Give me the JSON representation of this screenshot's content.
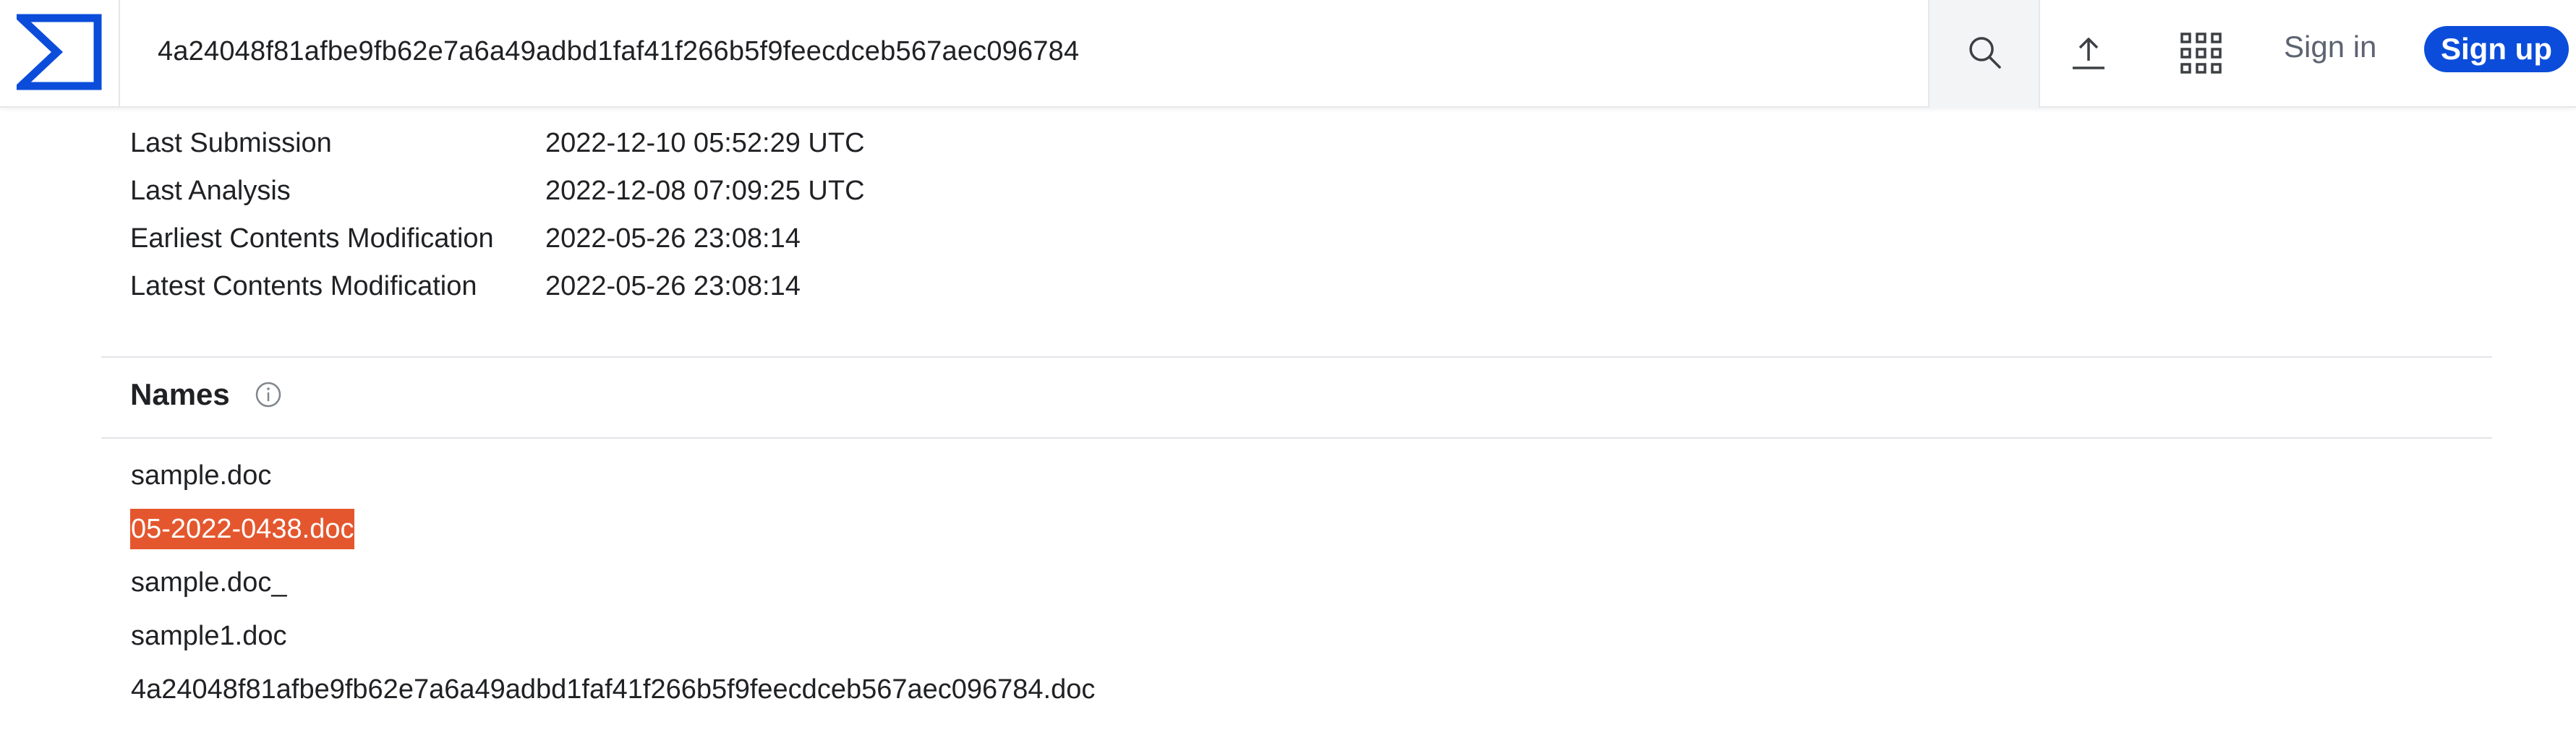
{
  "header": {
    "search_value": "4a24048f81afbe9fb62e7a6a49adbd1faf41f266b5f9feecdceb567aec096784",
    "sign_in_label": "Sign in",
    "sign_up_label": "Sign up",
    "logo_icon": "virustotal-logo-icon",
    "search_icon": "search-icon",
    "upload_icon": "upload-icon",
    "apps_icon": "apps-grid-icon",
    "brand_color": "#0b4dda"
  },
  "details": [
    {
      "label": "Last Submission",
      "value": "2022-12-10 05:52:29 UTC"
    },
    {
      "label": "Last Analysis",
      "value": "2022-12-08 07:09:25 UTC"
    },
    {
      "label": "Earliest Contents Modification",
      "value": "2022-05-26 23:08:14"
    },
    {
      "label": "Latest Contents Modification",
      "value": "2022-05-26 23:08:14"
    }
  ],
  "names_section": {
    "title": "Names",
    "info_icon": "info-icon",
    "items": [
      "sample.doc",
      "05-2022-0438.doc",
      "sample.doc_",
      "sample1.doc",
      "4a24048f81afbe9fb62e7a6a49adbd1faf41f266b5f9feecdceb567aec096784.doc"
    ],
    "highlight_color": "#e4572e"
  }
}
